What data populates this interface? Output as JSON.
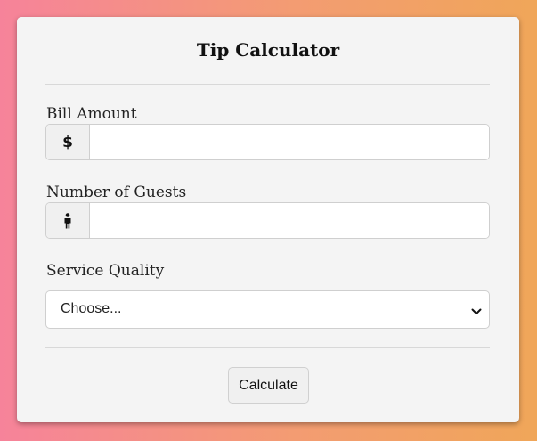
{
  "card": {
    "title": "Tip Calculator"
  },
  "bill": {
    "label": "Bill Amount",
    "prefix": "$",
    "value": "",
    "placeholder": ""
  },
  "guests": {
    "label": "Number of Guests",
    "icon": "person-icon",
    "value": "",
    "placeholder": ""
  },
  "service": {
    "label": "Service Quality",
    "selected": "Choose..."
  },
  "actions": {
    "calculate_label": "Calculate"
  },
  "colors": {
    "background_start": "#f6839a",
    "background_end": "#f0a659",
    "card": "#f4f4f4"
  }
}
